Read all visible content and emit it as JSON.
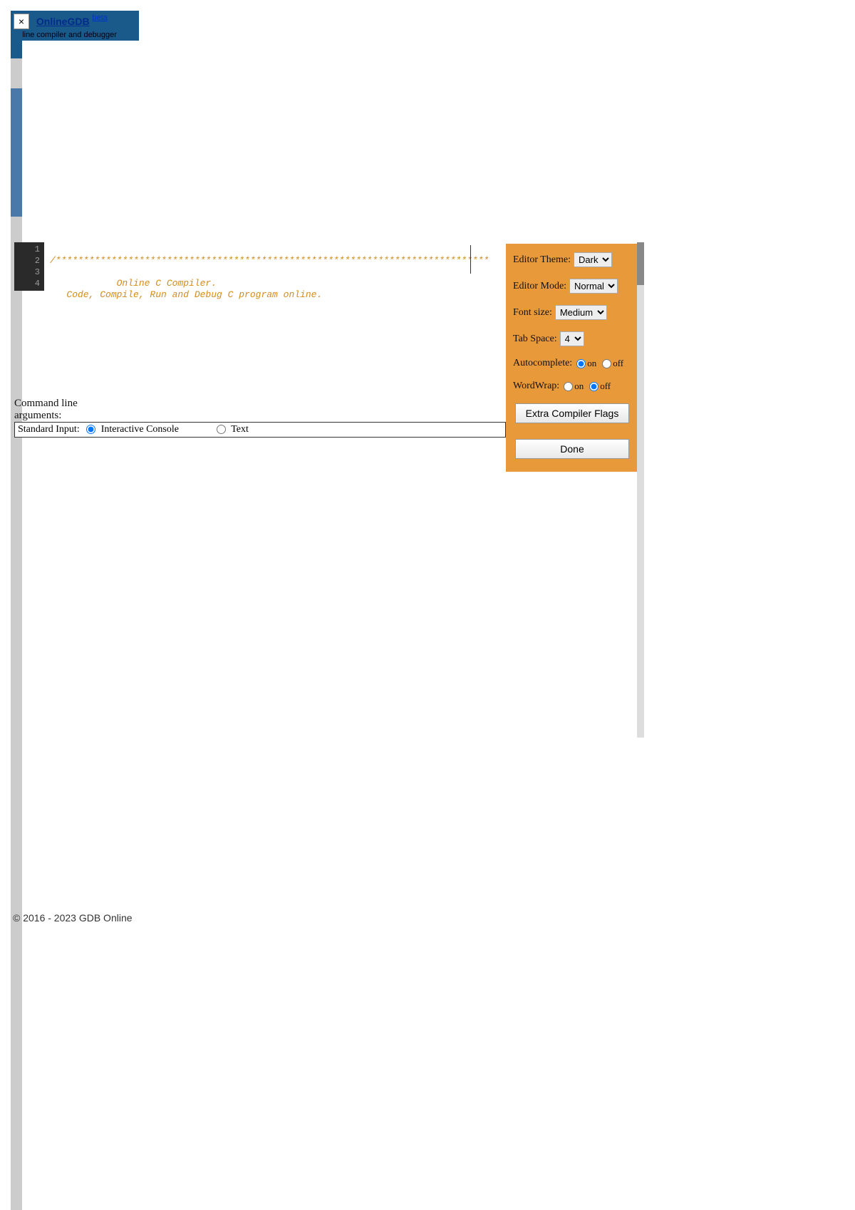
{
  "header": {
    "close_glyph": "×",
    "brand": "OnlineGDB",
    "beta": "beta",
    "tagline": "online compiler and debugger"
  },
  "editor": {
    "line_numbers": [
      "1",
      "2",
      "3",
      "4"
    ],
    "line1": "/******************************************************************************",
    "line3": "            Online C Compiler.",
    "line4": "   Code, Compile, Run and Debug C program online."
  },
  "settings": {
    "theme_label": "Editor Theme:",
    "theme_value": "Dark",
    "mode_label": "Editor Mode:",
    "mode_value": "Normal",
    "font_label": "Font size:",
    "font_value": "Medium",
    "tab_label": "Tab Space:",
    "tab_value": "4",
    "autocomplete_label": "Autocomplete:",
    "on": "on",
    "off": "off",
    "wordwrap_label": "WordWrap:",
    "flags_btn": "Extra Compiler Flags",
    "done_btn": "Done"
  },
  "cmdline": {
    "label_line1": "Command line",
    "label_line2": "arguments:",
    "stdin_label": "Standard Input:",
    "opt_interactive": "Interactive Console",
    "opt_text": "Text"
  },
  "footer": {
    "copyright": "© 2016 - 2023 GDB Online"
  }
}
